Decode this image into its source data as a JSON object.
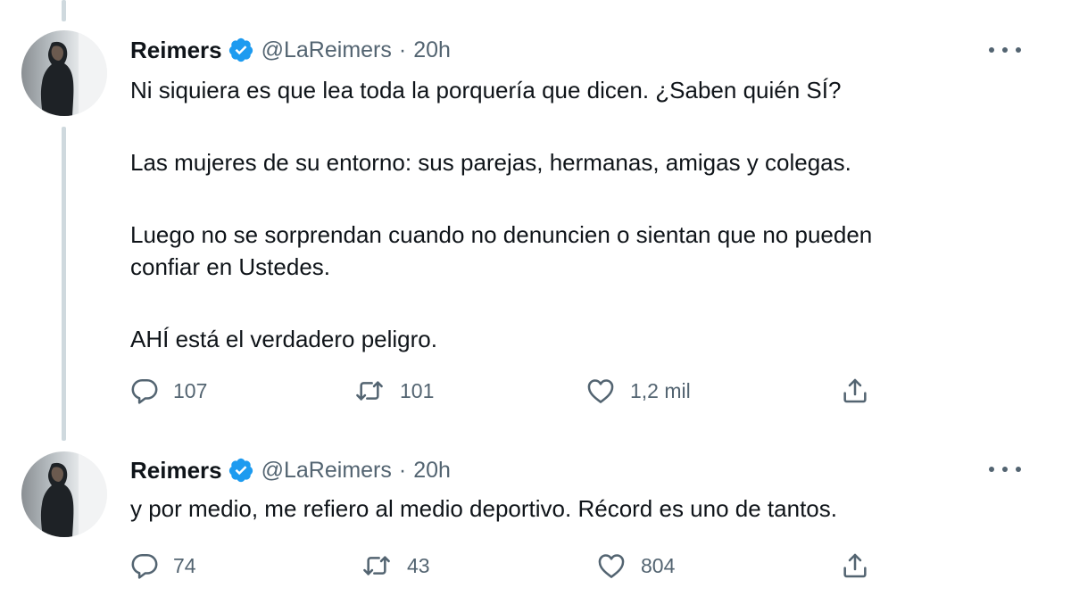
{
  "tweets": [
    {
      "author": {
        "name": "Reimers",
        "handle": "@LaReimers",
        "separator": "·",
        "time": "20h"
      },
      "paragraphs": [
        "Ni siquiera es que lea toda la porquería que dicen. ¿Saben quién SÍ?",
        "Las mujeres de su entorno: sus parejas, hermanas, amigas y colegas.",
        "Luego no se sorprendan cuando no denuncien o sientan que no pueden",
        "confiar en Ustedes.",
        "AHÍ está el verdadero peligro."
      ],
      "stats": {
        "replies": "107",
        "retweets": "101",
        "likes": "1,2 mil"
      }
    },
    {
      "author": {
        "name": "Reimers",
        "handle": "@LaReimers",
        "separator": "·",
        "time": "20h"
      },
      "paragraphs": [
        "y por medio, me refiero al medio deportivo. Récord es uno de tantos."
      ],
      "stats": {
        "replies": "74",
        "retweets": "43",
        "likes": "804"
      }
    }
  ],
  "colors": {
    "verified": "#1d9bf0",
    "text": "#0f1419",
    "secondary": "#536471",
    "thread_line": "#cfd9de"
  },
  "icons": [
    "verified-badge-icon",
    "more-icon",
    "reply-icon",
    "retweet-icon",
    "like-icon",
    "share-icon"
  ]
}
